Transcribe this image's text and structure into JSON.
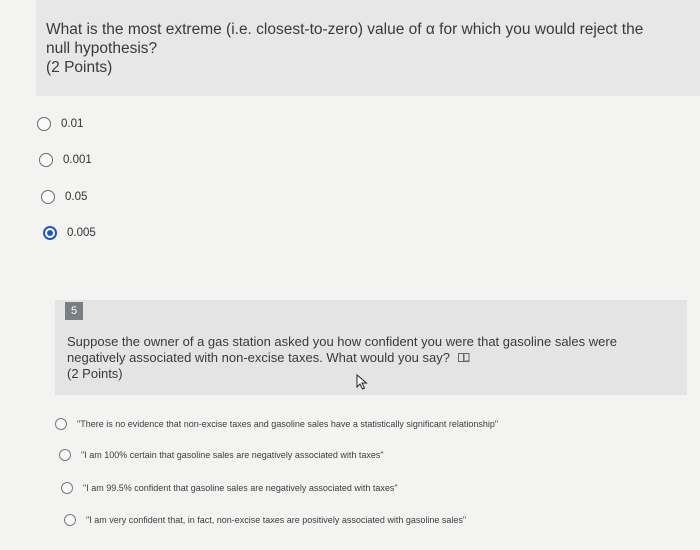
{
  "question4": {
    "text": "What is the most extreme (i.e. closest-to-zero) value of α for which you would reject the null hypothesis?",
    "points": "(2 Points)",
    "options": [
      {
        "label": "0.01",
        "selected": false
      },
      {
        "label": "0.001",
        "selected": false
      },
      {
        "label": "0.05",
        "selected": false
      },
      {
        "label": "0.005",
        "selected": true
      }
    ]
  },
  "question5": {
    "number": "5",
    "text": "Suppose the owner of a gas station asked you how confident you were that gasoline sales were negatively associated with non-excise taxes. What would you say?",
    "points": "(2 Points)",
    "options": [
      {
        "label": "\"There is no evidence that non-excise taxes and gasoline sales have a statistically significant relationship\"",
        "selected": false
      },
      {
        "label": "\"I am 100% certain that gasoline sales are negatively associated with taxes\"",
        "selected": false
      },
      {
        "label": "\"I am 99.5% confident that gasoline sales are negatively associated with taxes\"",
        "selected": false
      },
      {
        "label": "\"I am very confident that, in fact, non-excise taxes are positively associated with gasoline sales\"",
        "selected": false
      }
    ]
  },
  "icons": {
    "immersive_reader": "immersive-reader-icon",
    "cursor": "mouse-cursor-icon"
  },
  "colors": {
    "selected_radio": "#1e56c8",
    "question_bg": "#e6e7e6",
    "page_bg": "#f3f3f2",
    "number_badge": "#7a7f84"
  }
}
